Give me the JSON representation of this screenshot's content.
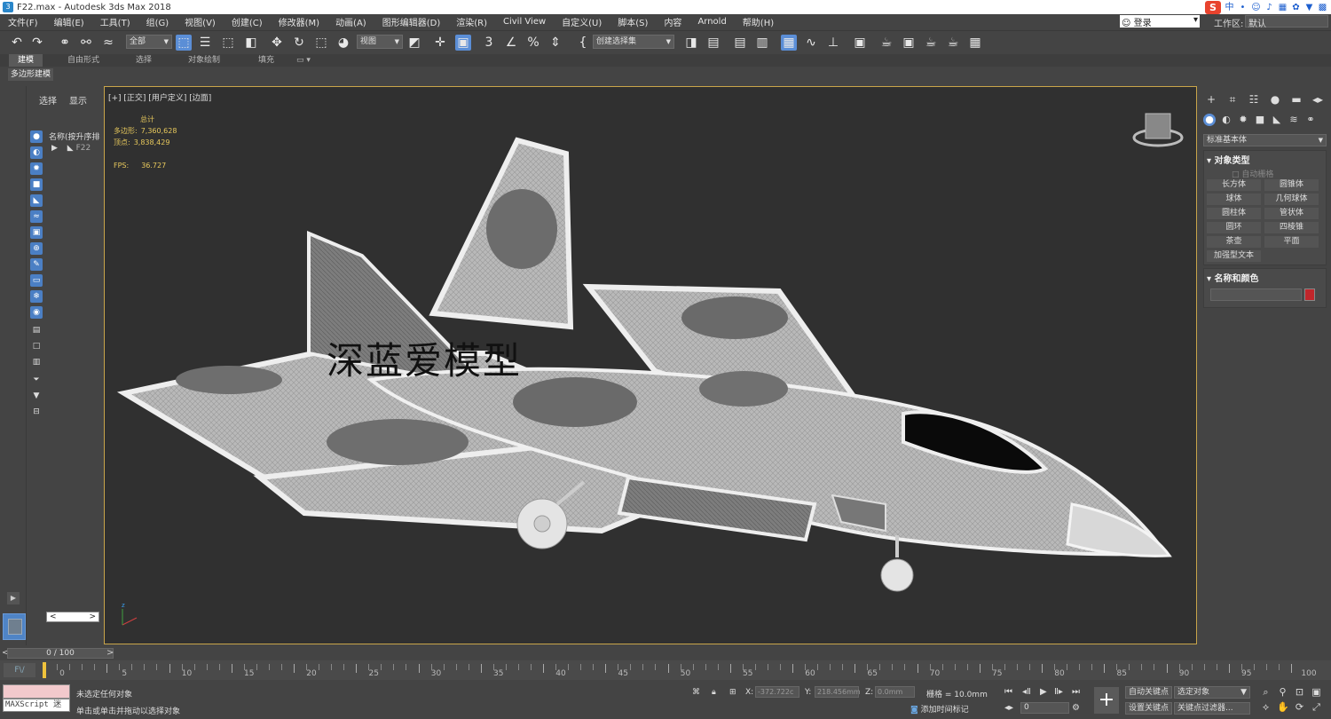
{
  "window": {
    "title": "F22.max - Autodesk 3ds Max 2018"
  },
  "menu": [
    "文件(F)",
    "编辑(E)",
    "工具(T)",
    "组(G)",
    "视图(V)",
    "创建(C)",
    "修改器(M)",
    "动画(A)",
    "图形编辑器(D)",
    "渲染(R)",
    "Civil View",
    "自定义(U)",
    "脚本(S)",
    "内容",
    "Arnold",
    "帮助(H)"
  ],
  "account": {
    "login": "登录",
    "workspace_label": "工作区:",
    "workspace_value": "默认"
  },
  "toolbar": {
    "selection_filter": "全部",
    "ref_coord": "视图",
    "named_selection": "创建选择集"
  },
  "ribbon": {
    "tabs": [
      "建模",
      "自由形式",
      "选择",
      "对象绘制",
      "填充"
    ],
    "selected_tab": "建模",
    "panel_chip": "多边形建模"
  },
  "explorer": {
    "tabs": [
      "选择",
      "显示"
    ],
    "column_header": "名称(按升序排",
    "row_object": "F22"
  },
  "viewport": {
    "label": "[+] [正交] [用户定义] [边面]",
    "stats_total": "总计",
    "poly_label": "多边形:",
    "poly_value": "7,360,628",
    "vert_label": "顶点:",
    "vert_value": "3,838,429",
    "fps_label": "FPS:",
    "fps_value": "36.727",
    "watermark": "深蓝爱模型"
  },
  "command_panel": {
    "category_dropdown": "标准基本体",
    "object_type_title": "对象类型",
    "autogrid": "自动栅格",
    "buttons": [
      "长方体",
      "圆锥体",
      "球体",
      "几何球体",
      "圆柱体",
      "管状体",
      "圆环",
      "四棱锥",
      "茶壶",
      "平面",
      "加强型文本"
    ],
    "name_color_title": "名称和颜色"
  },
  "timeline": {
    "slider": "0 / 100",
    "curve_btn": "F\\/"
  },
  "status": {
    "maxscript": "MAXScript 迷",
    "msg_selection": "未选定任何对象",
    "msg_hint": "单击或单击并拖动以选择对象",
    "x_label": "X:",
    "x_value": "-372.722c",
    "y_label": "Y:",
    "y_value": "218.456mm",
    "z_label": "Z:",
    "z_value": "0.0mm",
    "grid": "栅格 = 10.0mm",
    "add_time_tag": "添加时间标记",
    "frame_value": "0",
    "auto_key": "自动关键点",
    "selected_obj": "选定对象",
    "set_key": "设置关键点",
    "key_filters": "关键点过滤器..."
  },
  "colors": {
    "viewport_border": "#c9a54a",
    "stats_text": "#e7c85c",
    "accent_blue": "#5b8ed6",
    "name_swatch": "#c0262b"
  }
}
